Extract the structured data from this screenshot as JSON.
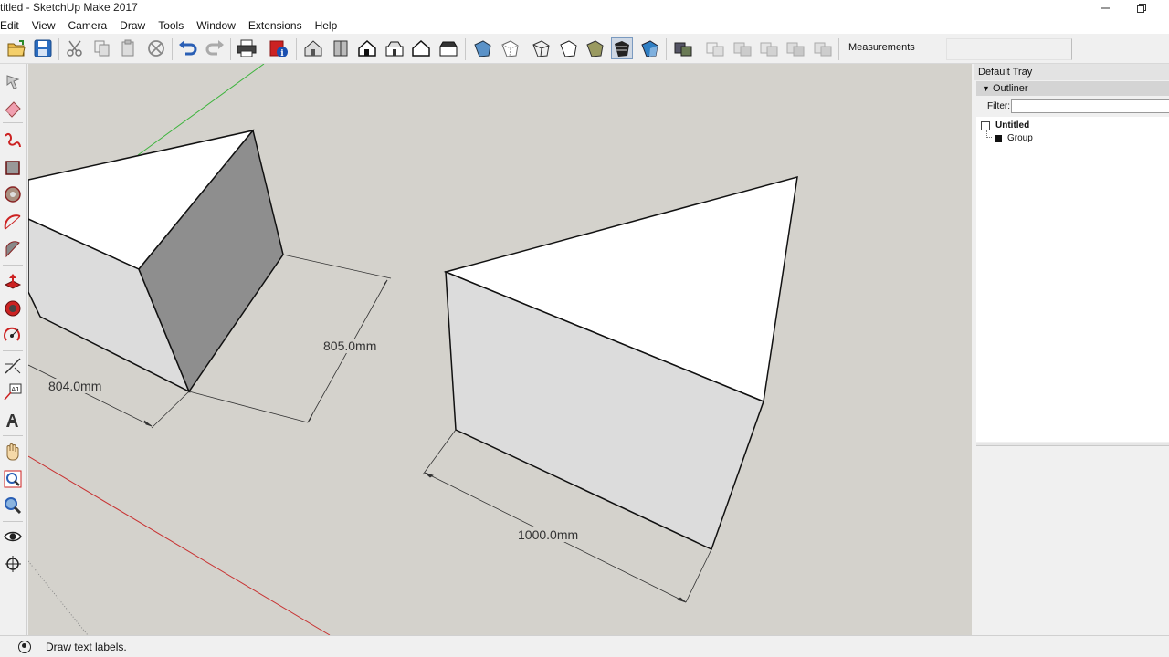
{
  "window": {
    "title": "titled - SketchUp Make 2017",
    "minimize_icon": "minimize-icon",
    "restore_icon": "restore-icon"
  },
  "menu": [
    "Edit",
    "View",
    "Camera",
    "Draw",
    "Tools",
    "Window",
    "Extensions",
    "Help"
  ],
  "toolbar": {
    "measurements_label": "Measurements",
    "measurements_value": ""
  },
  "viewport": {
    "dimensions": {
      "dim1": "804.0mm",
      "dim2": "805.0mm",
      "dim3": "1000.0mm"
    },
    "colors": {
      "background": "#d4d2cc",
      "red_axis": "#c83232",
      "green_axis": "#3cb43c",
      "face_top": "#ffffff",
      "face_side_light": "#dcdcdc",
      "face_side_dark": "#8e8e8e"
    }
  },
  "tray": {
    "title": "Default Tray",
    "outliner": {
      "title": "Outliner",
      "filter_label": "Filter:",
      "filter_value": "",
      "root": "Untitled",
      "children": [
        "Group"
      ]
    }
  },
  "status": {
    "text": "Draw text labels."
  }
}
